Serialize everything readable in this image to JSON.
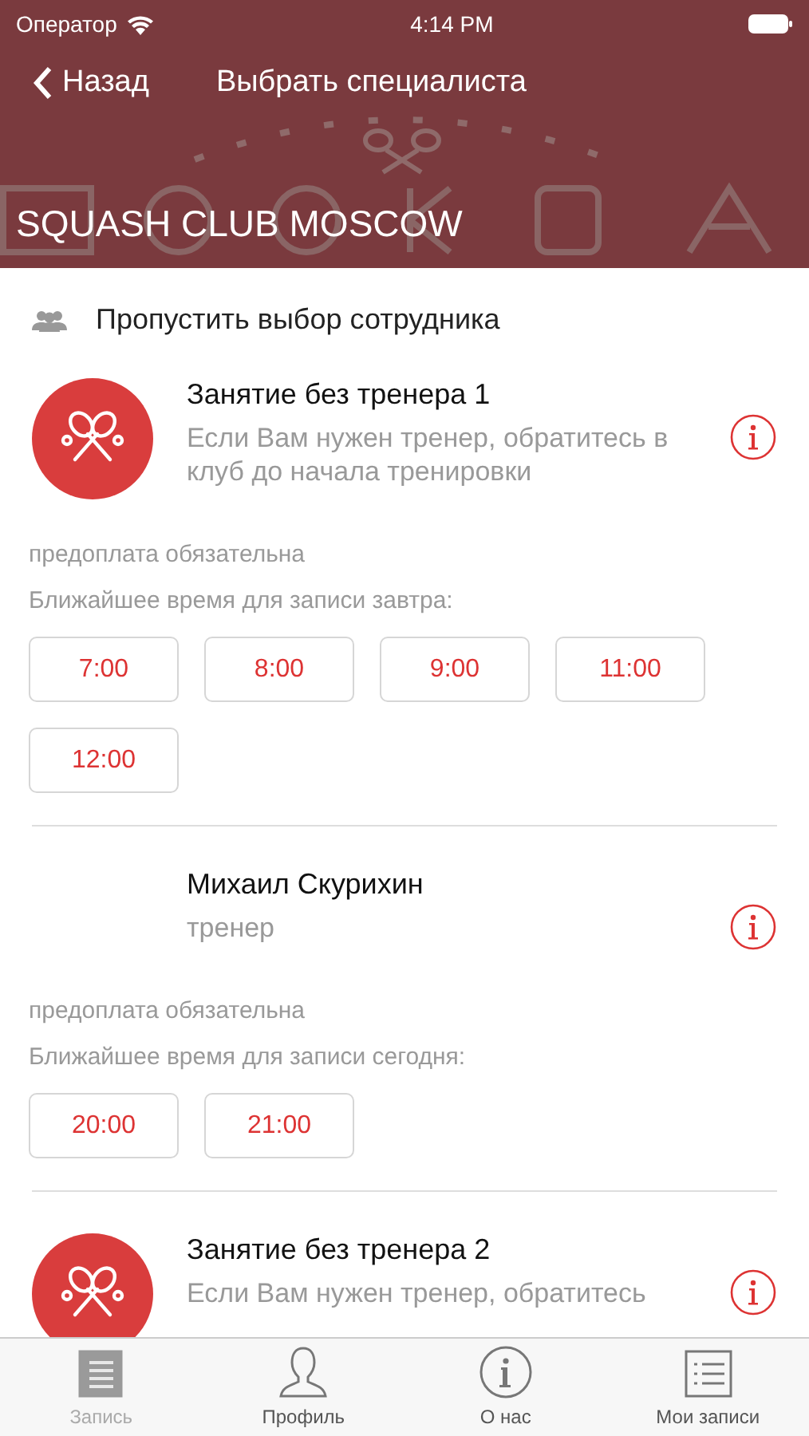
{
  "status_bar": {
    "carrier": "Оператор",
    "time": "4:14 PM"
  },
  "nav": {
    "back": "Назад",
    "title": "Выбрать специалиста"
  },
  "header": {
    "kind": "picture",
    "club_name": "SQUASH CLUB MOSCOW"
  },
  "skip": {
    "label": "Пропустить выбор сотрудника"
  },
  "specialists": [
    {
      "kind": "class",
      "name": "Занятие без тренера 1",
      "subtitle": "Если Вам нужен тренер, обратитесь в клуб до начала тренировки",
      "note": "предоплата обязательна",
      "nearest": "Ближайшее время для записи завтра:",
      "times": [
        "7:00",
        "8:00",
        "9:00",
        "11:00",
        "12:00"
      ]
    },
    {
      "kind": "trainer",
      "name": "Михаил Скурихин",
      "subtitle": "тренер",
      "note": "предоплата обязательна",
      "nearest": "Ближайшее время для записи сегодня:",
      "times": [
        "20:00",
        "21:00"
      ]
    },
    {
      "kind": "class",
      "name": "Занятие без тренера 2",
      "subtitle": "Если Вам нужен тренер, обратитесь"
    }
  ],
  "tabs": [
    {
      "kind": "booking",
      "label": "Запись",
      "selected": true
    },
    {
      "kind": "profile",
      "label": "Профиль",
      "selected": false
    },
    {
      "kind": "about",
      "label": "О нас",
      "selected": false
    },
    {
      "kind": "list",
      "label": "Мои записи",
      "selected": false
    }
  ]
}
